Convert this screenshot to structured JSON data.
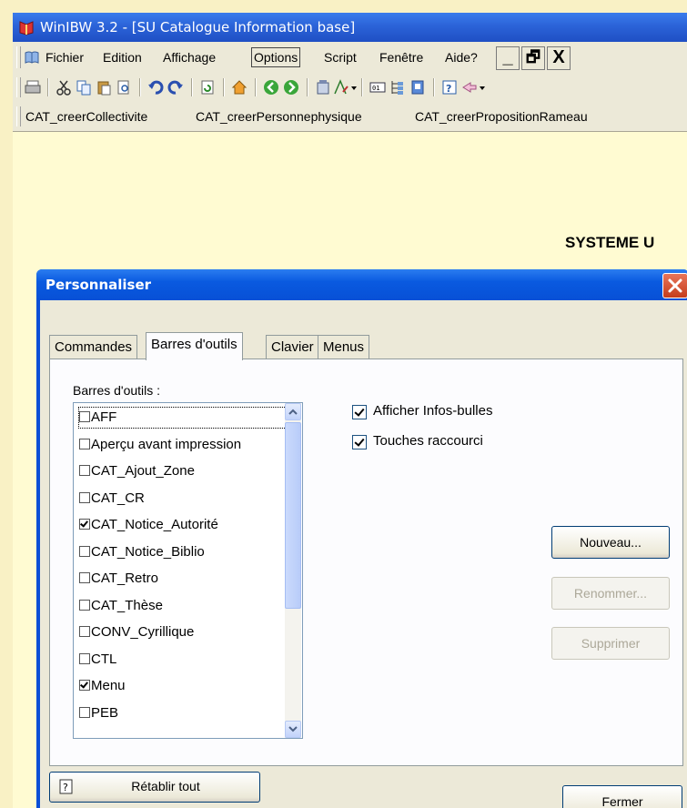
{
  "window": {
    "title": "WinIBW 3.2 - [SU Catalogue Information base]"
  },
  "menubar": {
    "items": [
      "Fichier",
      "Edition",
      "Affichage",
      "Options",
      "Script",
      "Fenêtre",
      "Aide?"
    ],
    "active": "Options",
    "controls": [
      "_",
      "🗗",
      "X"
    ]
  },
  "scriptbar": {
    "items": [
      "CAT_creerCollectivite",
      "CAT_creerPersonnephysique",
      "CAT_creerPropositionRameau"
    ]
  },
  "document": {
    "heading": "SYSTEME U"
  },
  "dialog": {
    "title": "Personnaliser",
    "tabs": [
      "Commandes",
      "Barres d'outils",
      "Clavier",
      "Menus"
    ],
    "active_tab": "Barres d'outils",
    "list_label": "Barres d'outils :",
    "toolbars": [
      {
        "name": "AFF",
        "checked": false
      },
      {
        "name": "Aperçu avant impression",
        "checked": false
      },
      {
        "name": "CAT_Ajout_Zone",
        "checked": false
      },
      {
        "name": "CAT_CR",
        "checked": false
      },
      {
        "name": "CAT_Notice_Autorité",
        "checked": true
      },
      {
        "name": "CAT_Notice_Biblio",
        "checked": false
      },
      {
        "name": "CAT_Retro",
        "checked": false
      },
      {
        "name": "CAT_Thèse",
        "checked": false
      },
      {
        "name": "CONV_Cyrillique",
        "checked": false
      },
      {
        "name": "CTL",
        "checked": false
      },
      {
        "name": "Menu",
        "checked": true
      },
      {
        "name": "PEB",
        "checked": false
      }
    ],
    "options": {
      "show_tooltips": {
        "label": "Afficher Infos-bulles",
        "checked": true
      },
      "shortcut_keys": {
        "label": "Touches raccourci",
        "checked": true
      }
    },
    "buttons": {
      "new": "Nouveau...",
      "rename": "Renommer...",
      "delete": "Supprimer",
      "reset_all": "Rétablir tout",
      "close": "Fermer"
    }
  },
  "colors": {
    "title_bar": "#2b63d8",
    "dialog_frame": "#0b4fd6",
    "close_button": "#d9522c",
    "background": "#fffbd2"
  }
}
